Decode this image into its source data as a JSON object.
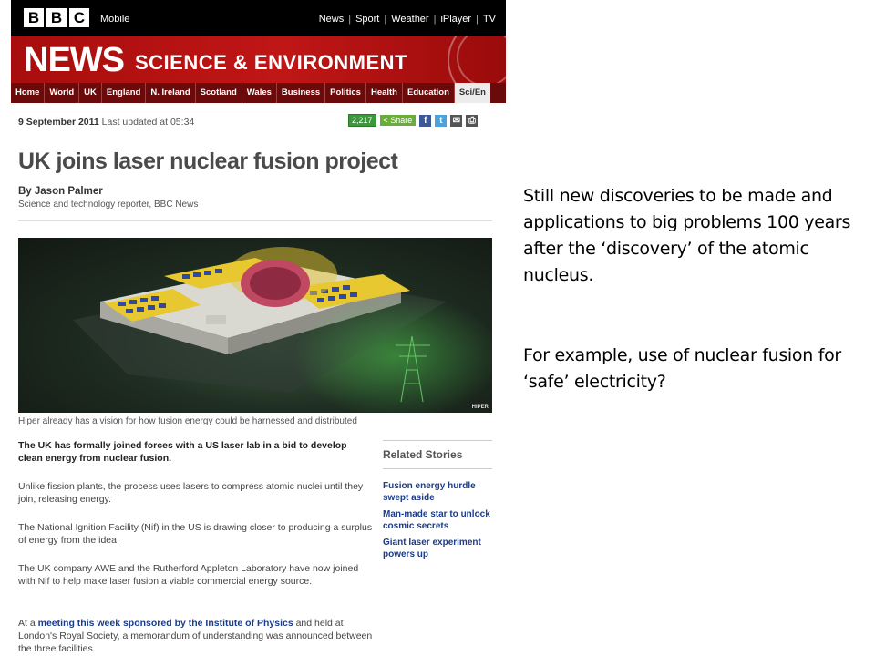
{
  "bbc": {
    "logo_letters": [
      "B",
      "B",
      "C"
    ],
    "mobile_label": "Mobile",
    "top_nav": [
      "News",
      "Sport",
      "Weather",
      "iPlayer",
      "TV"
    ]
  },
  "banner": {
    "news": "NEWS",
    "section": "SCIENCE & ENVIRONMENT"
  },
  "section_nav": [
    "Home",
    "World",
    "UK",
    "England",
    "N. Ireland",
    "Scotland",
    "Wales",
    "Business",
    "Politics",
    "Health",
    "Education",
    "Sci/En"
  ],
  "article": {
    "date": "9 September 2011",
    "updated": "Last updated at 05:34",
    "share_count": "2,217",
    "share_label": "Share",
    "headline": "UK joins laser nuclear fusion project",
    "author": "By Jason Palmer",
    "author_role": "Science and technology reporter, BBC News",
    "image_tag": "HIPER",
    "caption": "Hiper already has a vision for how fusion energy could be harnessed and distributed",
    "lead": "The UK has formally joined forces with a US laser lab in a bid to develop clean energy from nuclear fusion.",
    "p1": "Unlike fission plants, the process uses lasers to compress atomic nuclei until they join, releasing energy.",
    "p2": "The National Ignition Facility (Nif) in the US is drawing closer to producing a surplus of energy from the idea.",
    "p3": "The UK company AWE and the Rutherford Appleton Laboratory have now joined with Nif to help make laser fusion a viable commercial energy source.",
    "p4_pre": "At a ",
    "p4_link": "meeting this week sponsored by the Institute of Physics",
    "p4_post": " and held at London's Royal Society, a memorandum of understanding was announced between the three facilities."
  },
  "related": {
    "title": "Related Stories",
    "stories": [
      "Fusion energy hurdle swept aside",
      "Man-made star to unlock cosmic secrets",
      "Giant laser experiment powers up"
    ]
  },
  "slide": {
    "para1": "Still new discoveries to be made and applications to big problems 100 years after the ‘discovery’ of the atomic nucleus.",
    "para2": "For example, use of nuclear fusion for ‘safe’ electricity?"
  }
}
